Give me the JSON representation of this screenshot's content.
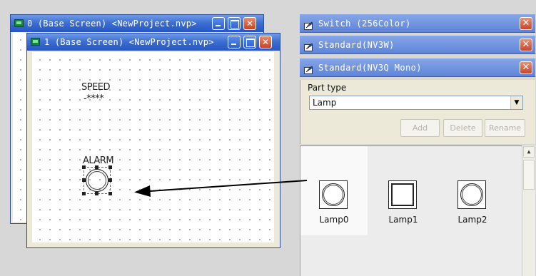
{
  "window_back": {
    "title": "0 (Base Screen) <NewProject.nvp>"
  },
  "window_front": {
    "title": "1 (Base Screen) <NewProject.nvp>",
    "labels": {
      "speed": "SPEED",
      "speed_value": "-****",
      "alarm": "ALARM"
    }
  },
  "panels": {
    "switch": "Switch (256Color)",
    "standard_nv3w": "Standard(NV3W)",
    "standard_nv3q": "Standard(NV3Q Mono)"
  },
  "props": {
    "part_type_label": "Part type",
    "part_type_value": "Lamp",
    "add": "Add",
    "delete": "Delete",
    "rename": "Rename"
  },
  "gallery": [
    {
      "name": "Lamp0",
      "shape": "round",
      "selected": true
    },
    {
      "name": "Lamp1",
      "shape": "square",
      "selected": false
    },
    {
      "name": "Lamp2",
      "shape": "round",
      "selected": false
    }
  ],
  "colors": {
    "titlebar": "#2556c6",
    "close": "#c84326",
    "panel_head": "#5f84d8"
  }
}
